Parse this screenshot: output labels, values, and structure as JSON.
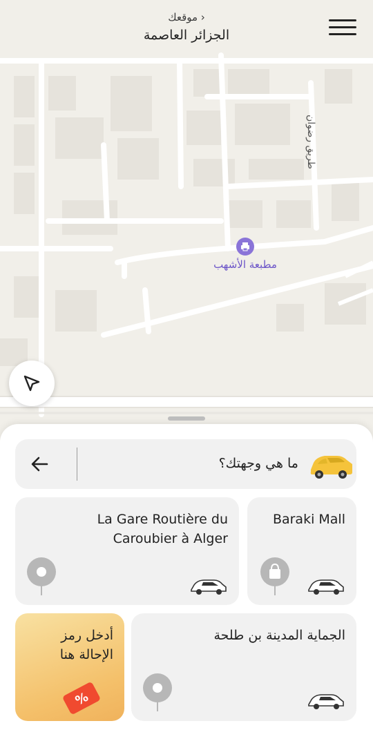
{
  "header": {
    "location_label": "موقعك ›",
    "city": "الجزائر العاصمة",
    "menu_icon": "menu-icon"
  },
  "map": {
    "poi_name": "مطبعة الأشهب",
    "street_name": "طريق رضوان"
  },
  "search": {
    "question": "ما هي وجهتك؟",
    "back_icon": "arrow-left-icon",
    "car_icon": "taxi-car-icon"
  },
  "destinations": [
    {
      "title_line1": "La Gare Routière du",
      "title_line2": "Caroubier à Alger"
    },
    {
      "title_line1": "Baraki Mall"
    },
    {
      "title_line1": "الجماية المدينة بن طلحة"
    }
  ],
  "promo": {
    "line1": "أدخل رمز",
    "line2": "الإحالة هنا",
    "icon": "percent-coupon-icon"
  },
  "colors": {
    "accent_yellow": "#f5c33b",
    "poi_purple": "#8a74d8"
  }
}
